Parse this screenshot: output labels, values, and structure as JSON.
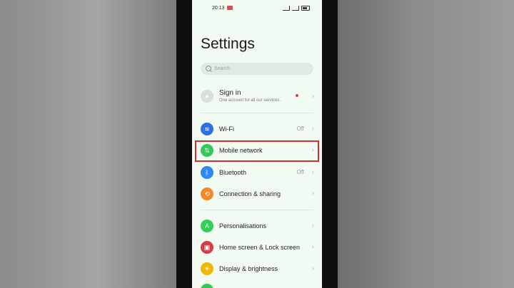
{
  "status": {
    "time": "20:13"
  },
  "page": {
    "title": "Settings"
  },
  "search": {
    "placeholder": "Search"
  },
  "account": {
    "title": "Sign in",
    "subtitle": "One account for all our services."
  },
  "items": [
    {
      "label": "Wi-Fi",
      "value": "Off",
      "icon": "wifi-icon",
      "color": "#2f6fe4"
    },
    {
      "label": "Mobile network",
      "value": "",
      "icon": "mobile-data-icon",
      "color": "#34c759"
    },
    {
      "label": "Bluetooth",
      "value": "Off",
      "icon": "bluetooth-icon",
      "color": "#2f86f6"
    },
    {
      "label": "Connection & sharing",
      "value": "",
      "icon": "share-icon",
      "color": "#f08a2a"
    },
    {
      "label": "Personalisations",
      "value": "",
      "icon": "palette-icon",
      "color": "#2fcf58"
    },
    {
      "label": "Home screen & Lock screen",
      "value": "",
      "icon": "home-screen-icon",
      "color": "#d93a4a"
    },
    {
      "label": "Display & brightness",
      "value": "",
      "icon": "sun-icon",
      "color": "#f0b800"
    }
  ],
  "colors": {
    "highlight": "#d0312d",
    "background": "#f2fbf2"
  }
}
